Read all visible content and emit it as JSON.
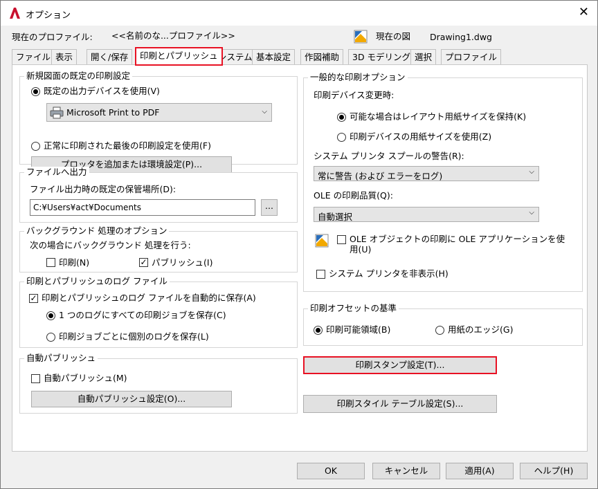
{
  "window": {
    "title": "オプション",
    "close_glyph": "✕"
  },
  "profile": {
    "label": "現在のプロファイル:",
    "value": "<<名前のな...プロファイル>>",
    "drawing_label": "現在の図",
    "drawing_value": "Drawing1.dwg"
  },
  "tabs": [
    "ファイル",
    "表示",
    "開く/保存",
    "印刷とパブリッシュ",
    "システム",
    "基本設定",
    "作図補助",
    "3D モデリング",
    "選択",
    "プロファイル"
  ],
  "new_drawing": {
    "title": "新規図面の既定の印刷設定",
    "use_default_device": "既定の出力デバイスを使用(V)",
    "device_value": "Microsoft Print to PDF",
    "use_last": "正常に印刷された最後の印刷設定を使用(F)",
    "add_plotter_button": "プロッタを追加または環境設定(P)..."
  },
  "file_output": {
    "title": "ファイルへ出力",
    "location_label": "ファイル出力時の既定の保管場所(D):",
    "location_value": "C:¥Users¥act¥Documents",
    "browse_button": "..."
  },
  "background": {
    "title": "バックグラウンド 処理のオプション",
    "desc": "次の場合にバックグラウンド 処理を行う:",
    "plot": "印刷(N)",
    "publish": "パブリッシュ(I)"
  },
  "log": {
    "title": "印刷とパブリッシュのログ ファイル",
    "auto_save": "印刷とパブリッシュのログ ファイルを自動的に保存(A)",
    "single_log": "1 つのログにすべての印刷ジョブを保存(C)",
    "separate_log": "印刷ジョブごとに個別のログを保存(L)"
  },
  "auto_publish": {
    "title": "自動パブリッシュ",
    "checkbox": "自動パブリッシュ(M)",
    "settings_button": "自動パブリッシュ設定(O)..."
  },
  "general": {
    "title": "一般的な印刷オプション",
    "device_change": "印刷デバイス変更時:",
    "keep_layout": "可能な場合はレイアウト用紙サイズを保持(K)",
    "use_device_paper": "印刷デバイスの用紙サイズを使用(Z)",
    "spool_label": "システム プリンタ スプールの警告(R):",
    "spool_value": "常に警告 (および エラーをログ)",
    "ole_label": "OLE の印刷品質(Q):",
    "ole_value": "自動選択",
    "ole_app_line1": "OLE オブジェクトの印刷に OLE アプリケーションを使",
    "ole_app_line2": "用(U)",
    "hide_printers": "システム プリンタを非表示(H)"
  },
  "offset": {
    "title": "印刷オフセットの基準",
    "printable": "印刷可能領域(B)",
    "edge": "用紙のエッジ(G)"
  },
  "stamp_button": "印刷スタンプ設定(T)...",
  "style_button": "印刷スタイル テーブル設定(S)...",
  "footer": {
    "ok": "OK",
    "cancel": "キャンセル",
    "apply": "適用(A)",
    "help": "ヘルプ(H)"
  },
  "colors": {
    "accent": "#e81123",
    "panel": "#ffffff",
    "window": "#f0f0f0"
  }
}
